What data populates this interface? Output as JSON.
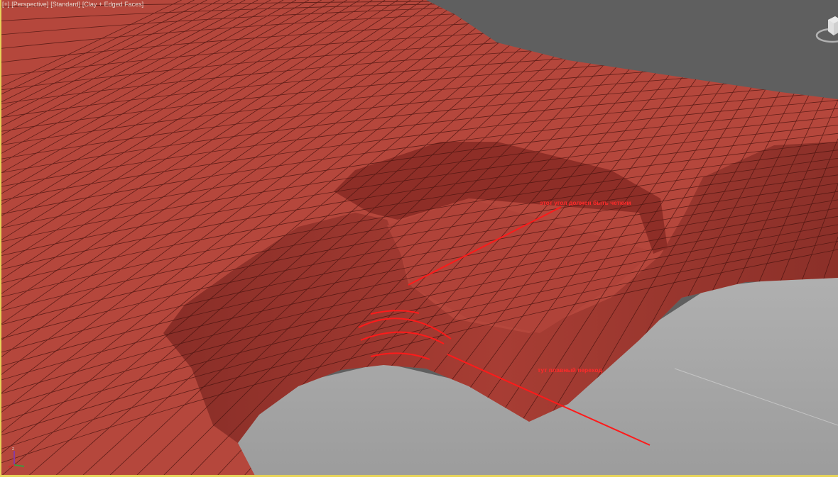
{
  "viewport": {
    "labels": [
      "[+]",
      "[Perspective]",
      "[Standard]",
      "[Clay + Edged Faces]"
    ],
    "active_border_color": "#e6d35a",
    "mesh_color": "#b5473c",
    "wire_color": "#4a1410",
    "background_color": "#5f5f5f",
    "floor_color": "#a9a9a9"
  },
  "annotations": {
    "sharp_corner_note": "этот угол должен быть четким",
    "smooth_transition_note": "тут плавный переход",
    "color": "#ff2a2a"
  },
  "gizmo": {
    "axes": [
      "x",
      "y",
      "z"
    ]
  },
  "viewcube": {
    "icon": "viewcube-icon"
  }
}
